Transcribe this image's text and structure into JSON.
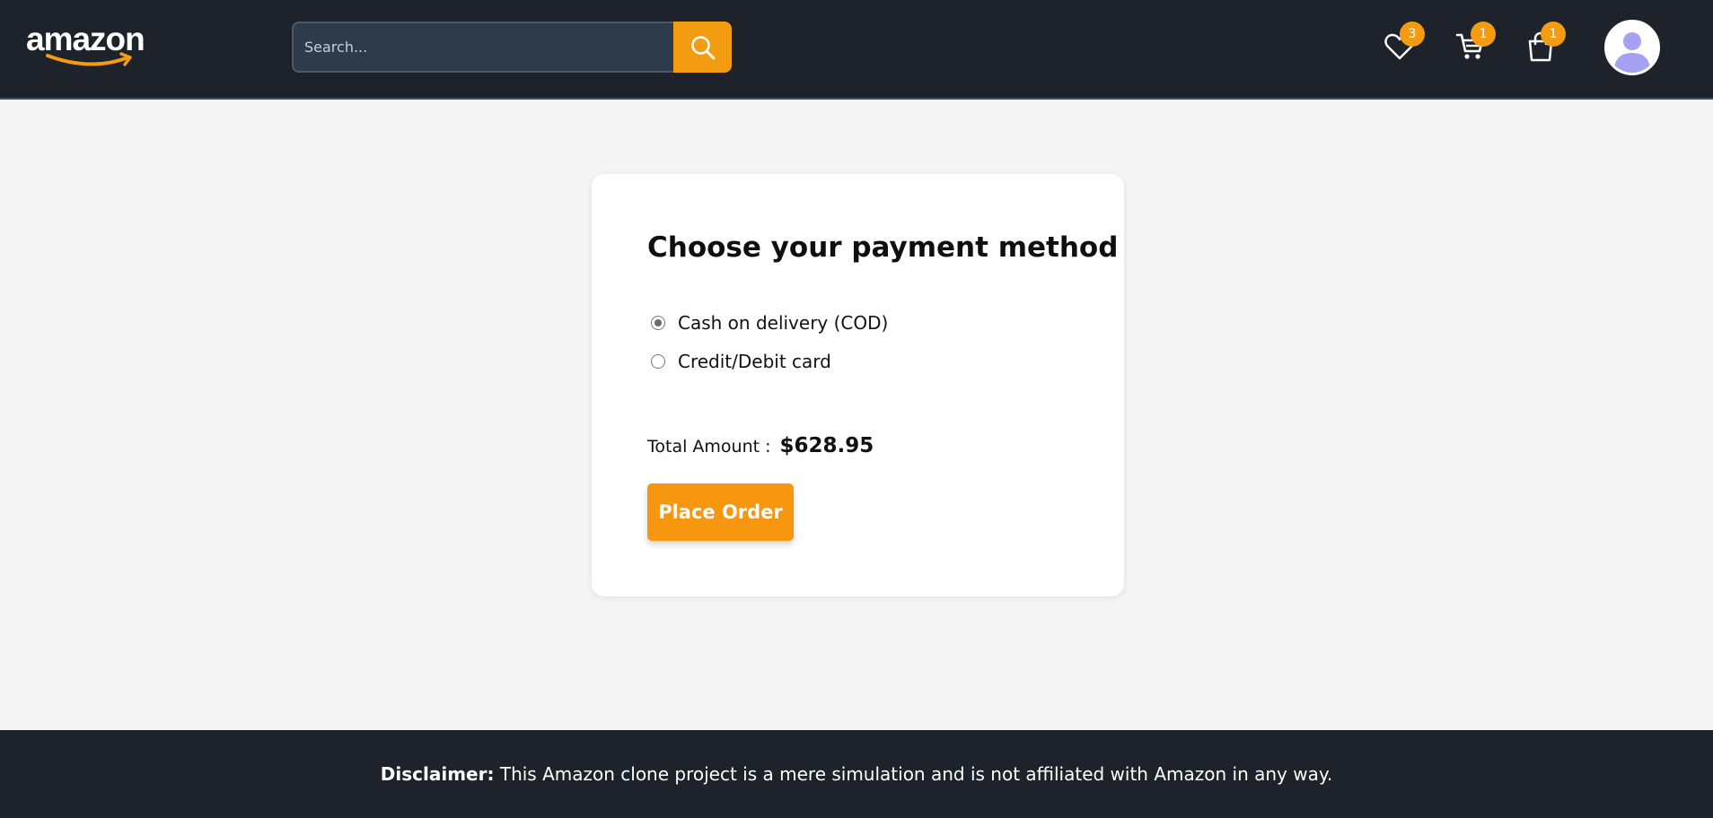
{
  "header": {
    "logo_text": "amazon",
    "search": {
      "placeholder": "Search...",
      "value": ""
    },
    "icons": [
      {
        "name": "wishlist",
        "count": "3"
      },
      {
        "name": "cart",
        "count": "1"
      },
      {
        "name": "orders",
        "count": "1"
      }
    ]
  },
  "payment": {
    "title": "Choose your payment method",
    "options": [
      {
        "label": "Cash on delivery (COD)",
        "selected": true
      },
      {
        "label": "Credit/Debit card",
        "selected": false
      }
    ],
    "total_label": "Total Amount :",
    "total_value": "$628.95",
    "place_order_label": "Place Order"
  },
  "footer": {
    "disclaimer_label": "Disclaimer:",
    "disclaimer_text": " This Amazon clone project is a mere simulation and is not affiliated with Amazon in any way."
  },
  "colors": {
    "header_bg": "#1e222b",
    "accent": "#f39c12",
    "page_bg": "#f4f4f4"
  }
}
